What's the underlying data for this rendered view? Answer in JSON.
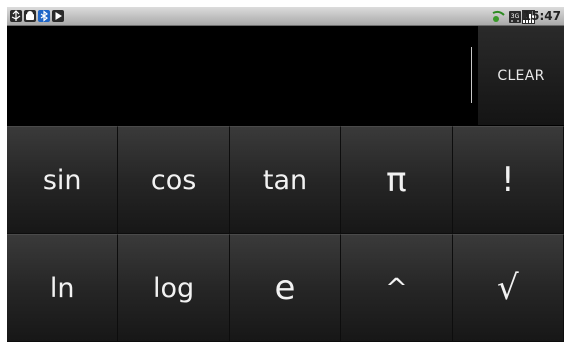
{
  "status_bar": {
    "left_icons": [
      "usb-debug-icon",
      "android-icon",
      "bluetooth-icon",
      "play-icon"
    ],
    "right_icons": [
      "sync-icon",
      "3g-icon",
      "signal-icon"
    ],
    "time": "15:47"
  },
  "display": {
    "value": "",
    "clear_label": "CLEAR"
  },
  "keypad": {
    "rows": [
      [
        "sin",
        "cos",
        "tan",
        "π",
        "!"
      ],
      [
        "ln",
        "log",
        "e",
        "^",
        "√"
      ]
    ]
  }
}
